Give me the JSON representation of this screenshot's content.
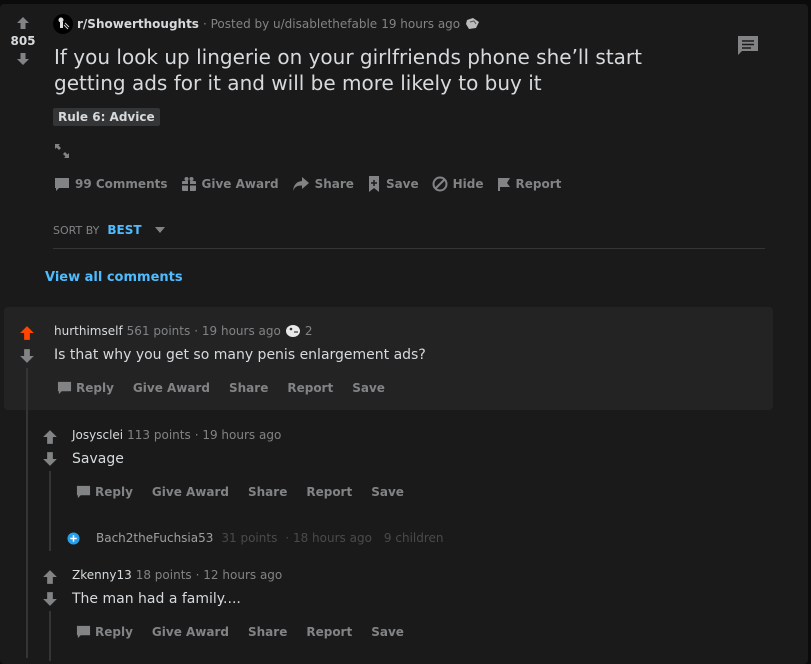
{
  "post": {
    "subreddit": "r/Showerthoughts",
    "posted_by": "· Posted by u/disablethefable",
    "time": "19 hours ago",
    "score": "805",
    "title": "If you look up lingerie on your girlfriends phone she’ll start getting ads for it and will be more likely to buy it",
    "flair": "Rule 6: Advice",
    "actions": {
      "comments": "99 Comments",
      "give_award": "Give Award",
      "share": "Share",
      "save": "Save",
      "hide": "Hide",
      "report": "Report"
    }
  },
  "sort": {
    "label": "SORT BY",
    "value": "BEST"
  },
  "view_all": "View all comments",
  "colors": {
    "upvote_active": "#ff4500",
    "link": "#4fbcff",
    "collapsed_icon": "#24a0ed"
  },
  "comments": [
    {
      "author": "hurthimself",
      "points": "561 points",
      "time": "· 19 hours ago",
      "award_count": "2",
      "body": "Is that why you get so many penis enlargement ads?",
      "actions": [
        "Reply",
        "Give Award",
        "Share",
        "Report",
        "Save"
      ],
      "upvoted": true
    },
    {
      "author": "Josysclei",
      "points": "113 points",
      "time": "· 19 hours ago",
      "body": "Savage",
      "actions": [
        "Reply",
        "Give Award",
        "Share",
        "Report",
        "Save"
      ]
    },
    {
      "author": "Bach2theFuchsia53",
      "points": "31 points",
      "time": "· 18 hours ago",
      "children": "9 children",
      "collapsed": true
    },
    {
      "author": "Zkenny13",
      "points": "18 points",
      "time": "· 12 hours ago",
      "body": "The man had a family....",
      "actions": [
        "Reply",
        "Give Award",
        "Share",
        "Report",
        "Save"
      ]
    }
  ]
}
